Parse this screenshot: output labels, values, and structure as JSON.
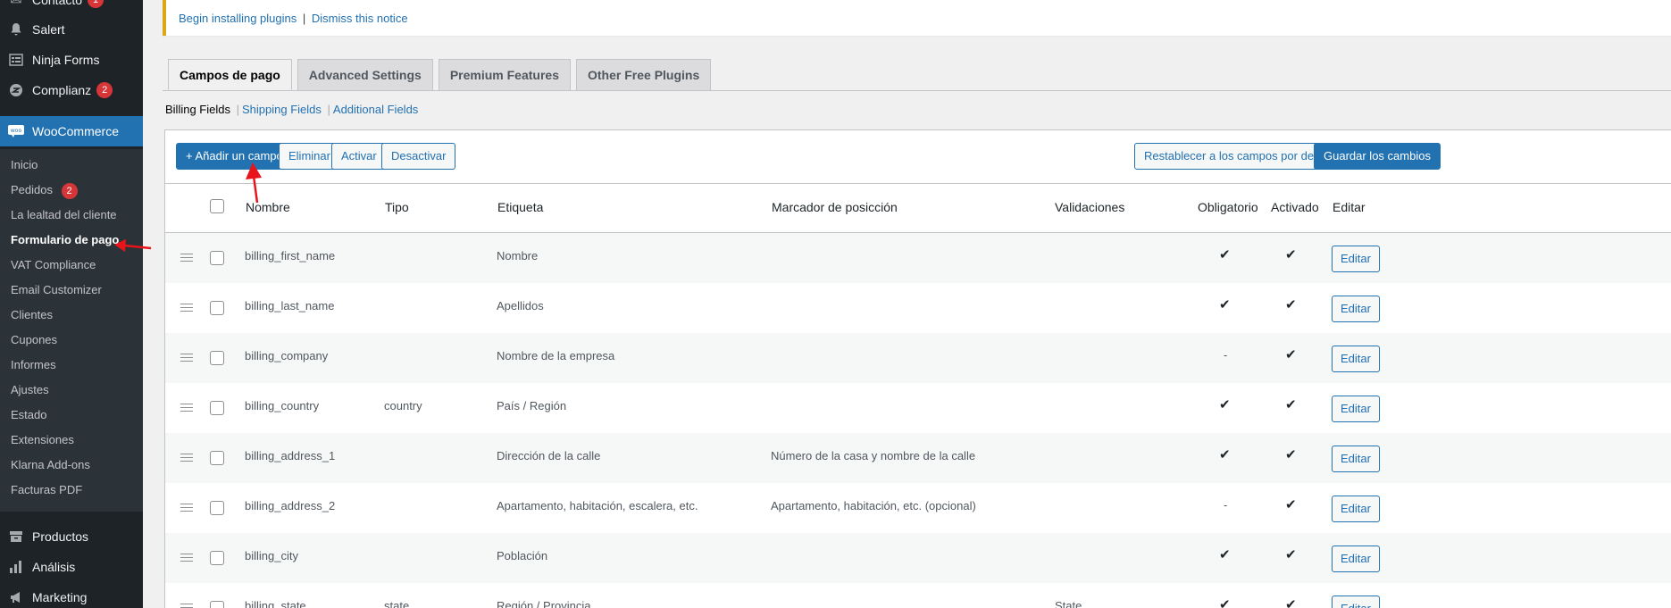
{
  "sidebar": {
    "items": [
      {
        "label": "Contacto",
        "icon": "envelope-icon",
        "badge": "1"
      },
      {
        "label": "Salert",
        "icon": "bell-icon",
        "badge": ""
      },
      {
        "label": "Ninja Forms",
        "icon": "form-icon",
        "badge": ""
      },
      {
        "label": "Complianz",
        "icon": "complianz-icon",
        "badge": "2"
      },
      {
        "label": "WooCommerce",
        "icon": "woo-icon",
        "badge": ""
      }
    ],
    "submenu": [
      {
        "label": "Inicio",
        "badge": ""
      },
      {
        "label": "Pedidos",
        "badge": "2"
      },
      {
        "label": "La lealtad del cliente",
        "badge": ""
      },
      {
        "label": "Formulario de pago",
        "badge": ""
      },
      {
        "label": "VAT Compliance",
        "badge": ""
      },
      {
        "label": "Email Customizer",
        "badge": ""
      },
      {
        "label": "Clientes",
        "badge": ""
      },
      {
        "label": "Cupones",
        "badge": ""
      },
      {
        "label": "Informes",
        "badge": ""
      },
      {
        "label": "Ajustes",
        "badge": ""
      },
      {
        "label": "Estado",
        "badge": ""
      },
      {
        "label": "Extensiones",
        "badge": ""
      },
      {
        "label": "Klarna Add-ons",
        "badge": ""
      },
      {
        "label": "Facturas PDF",
        "badge": ""
      }
    ],
    "bottom_items": [
      {
        "label": "Productos",
        "icon": "archive-icon"
      },
      {
        "label": "Análisis",
        "icon": "bar-chart-icon"
      },
      {
        "label": "Marketing",
        "icon": "megaphone-icon"
      }
    ]
  },
  "notice": {
    "link_install": "Begin installing plugins",
    "separator": "|",
    "link_dismiss": "Dismiss this notice"
  },
  "tabs": [
    "Campos de pago",
    "Advanced Settings",
    "Premium Features",
    "Other Free Plugins"
  ],
  "subsub": {
    "current": "Billing Fields",
    "links": [
      "Shipping Fields",
      "Additional Fields"
    ],
    "separator": "|"
  },
  "toolbar": {
    "add": "+ Añadir un campo",
    "remove": "Eliminar",
    "enable": "Activar",
    "disable": "Desactivar",
    "reset": "Restablecer a los campos por defecto",
    "save": "Guardar los cambios"
  },
  "table": {
    "headers": {
      "name": "Nombre",
      "type": "Tipo",
      "label": "Etiqueta",
      "placeholder": "Marcador de posicción",
      "validations": "Validaciones",
      "required": "Obligatorio",
      "enabled": "Activado",
      "edit": "Editar"
    },
    "edit_label": "Editar",
    "rows": [
      {
        "name": "billing_first_name",
        "type": "",
        "label": "Nombre",
        "placeholder": "",
        "validations": "",
        "required": "✔",
        "enabled": "✔"
      },
      {
        "name": "billing_last_name",
        "type": "",
        "label": "Apellidos",
        "placeholder": "",
        "validations": "",
        "required": "✔",
        "enabled": "✔"
      },
      {
        "name": "billing_company",
        "type": "",
        "label": "Nombre de la empresa",
        "placeholder": "",
        "validations": "",
        "required": "-",
        "enabled": "✔"
      },
      {
        "name": "billing_country",
        "type": "country",
        "label": "País / Región",
        "placeholder": "",
        "validations": "",
        "required": "✔",
        "enabled": "✔"
      },
      {
        "name": "billing_address_1",
        "type": "",
        "label": "Dirección de la calle",
        "placeholder": "Número de la casa y nombre de la calle",
        "validations": "",
        "required": "✔",
        "enabled": "✔"
      },
      {
        "name": "billing_address_2",
        "type": "",
        "label": "Apartamento, habitación, escalera, etc.",
        "placeholder": "Apartamento, habitación, etc. (opcional)",
        "validations": "",
        "required": "-",
        "enabled": "✔"
      },
      {
        "name": "billing_city",
        "type": "",
        "label": "Población",
        "placeholder": "",
        "validations": "",
        "required": "✔",
        "enabled": "✔"
      },
      {
        "name": "billing_state",
        "type": "state",
        "label": "Región / Provincia",
        "placeholder": "",
        "validations": "State",
        "required": "✔",
        "enabled": "✔"
      }
    ]
  },
  "colors": {
    "sidebar_bg": "#1d2327",
    "submenu_bg": "#2c3338",
    "accent": "#2271b1",
    "badge": "#d63638",
    "annotation_arrow": "#e8141a"
  }
}
